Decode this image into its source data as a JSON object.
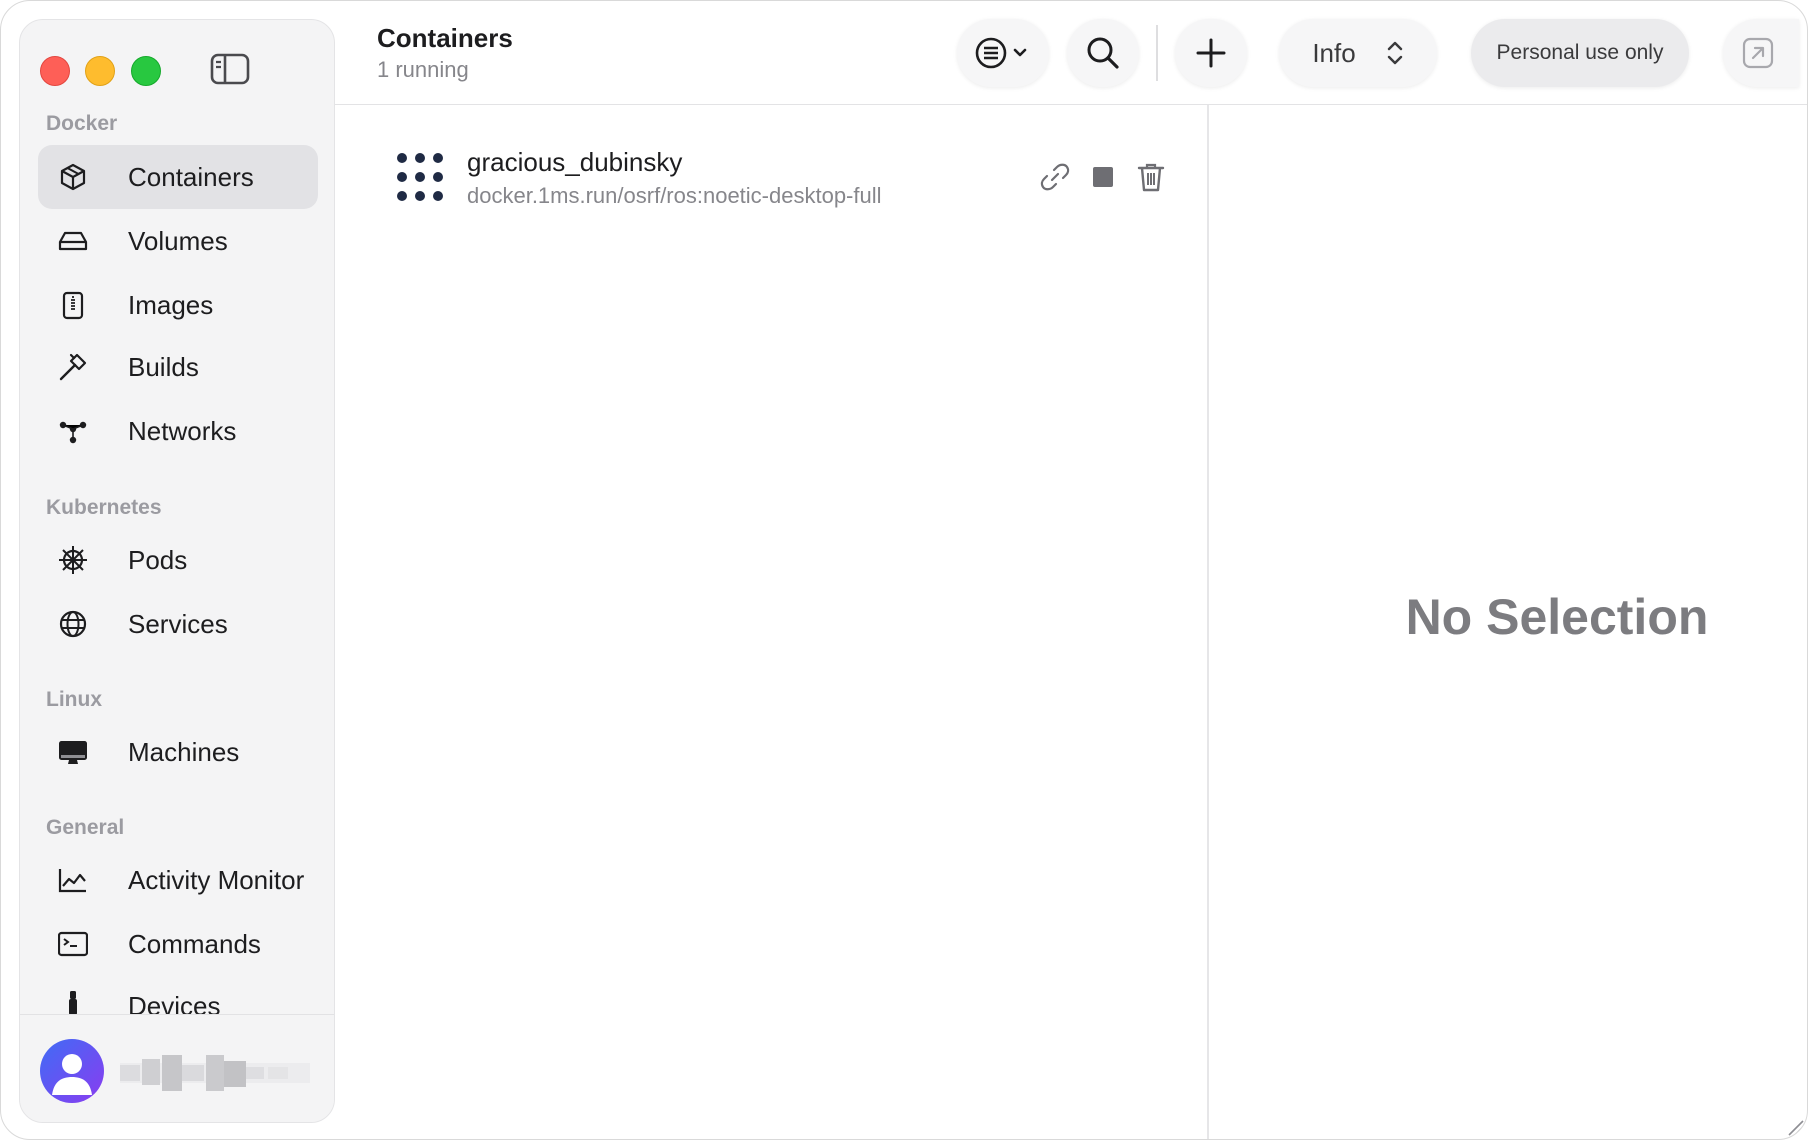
{
  "sidebar": {
    "sections": [
      {
        "label": "Docker"
      },
      {
        "label": "Kubernetes"
      },
      {
        "label": "Linux"
      },
      {
        "label": "General"
      }
    ],
    "items": [
      {
        "label": "Containers",
        "icon": "cube-icon",
        "selected": true
      },
      {
        "label": "Volumes",
        "icon": "drive-icon"
      },
      {
        "label": "Images",
        "icon": "archive-icon"
      },
      {
        "label": "Builds",
        "icon": "hammer-icon"
      },
      {
        "label": "Networks",
        "icon": "network-icon"
      },
      {
        "label": "Pods",
        "icon": "helm-icon"
      },
      {
        "label": "Services",
        "icon": "globe-icon"
      },
      {
        "label": "Machines",
        "icon": "desktop-icon"
      },
      {
        "label": "Activity Monitor",
        "icon": "chart-line-icon"
      },
      {
        "label": "Commands",
        "icon": "terminal-icon"
      },
      {
        "label": "Devices",
        "icon": "usb-icon"
      }
    ]
  },
  "header": {
    "title": "Containers",
    "subtitle": "1 running",
    "info_label": "Info",
    "personal_label": "Personal use only"
  },
  "containers": [
    {
      "name": "gracious_dubinsky",
      "image": "docker.1ms.run/osrf/ros:noetic-desktop-full",
      "status": "running"
    }
  ],
  "detail": {
    "empty_label": "No Selection"
  },
  "colors": {
    "accent_selected": "#e2e2e5",
    "traffic_close": "#fe5f57",
    "traffic_min": "#febc2e",
    "traffic_max": "#28c840",
    "running_dots": "#1f2a44"
  }
}
